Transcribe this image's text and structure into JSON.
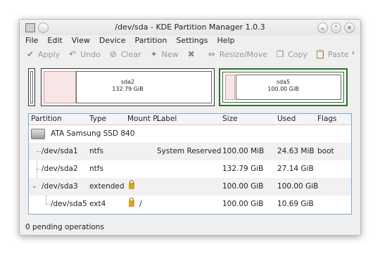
{
  "window": {
    "title": "/dev/sda - KDE Partition Manager 1.0.3"
  },
  "menu": [
    "File",
    "Edit",
    "View",
    "Device",
    "Partition",
    "Settings",
    "Help"
  ],
  "toolbar": {
    "apply": "Apply",
    "undo": "Undo",
    "clear": "Clear",
    "new": "New",
    "delete": "Delete",
    "resize": "Resize/Move",
    "copy": "Copy",
    "paste": "Paste"
  },
  "graph": {
    "sda2": {
      "name": "sda2",
      "size": "132.79 GiB"
    },
    "sda5": {
      "name": "sda5",
      "size": "100.00 GiB"
    }
  },
  "table": {
    "headers": [
      "Partition",
      "Type",
      "Mount P...",
      "Label",
      "Size",
      "Used",
      "Flags"
    ],
    "device": "ATA Samsung SSD 840",
    "rows": [
      {
        "partition": "/dev/sda1",
        "type": "ntfs",
        "mount": "",
        "label": "System Reserved",
        "size": "100.00 MiB",
        "used": "24.63 MiB",
        "flags": "boot",
        "locked": false
      },
      {
        "partition": "/dev/sda2",
        "type": "ntfs",
        "mount": "",
        "label": "",
        "size": "132.79 GiB",
        "used": "27.14 GiB",
        "flags": "",
        "locked": false
      },
      {
        "partition": "/dev/sda3",
        "type": "extended",
        "mount": "",
        "label": "",
        "size": "100.00 GiB",
        "used": "100.00 GiB",
        "flags": "",
        "locked": true
      },
      {
        "partition": "/dev/sda5",
        "type": "ext4",
        "mount": "/",
        "label": "",
        "size": "100.00 GiB",
        "used": "10.69 GiB",
        "flags": "",
        "locked": true
      }
    ]
  },
  "status": "0 pending operations",
  "colors": {
    "accent_border": "#7fa7cf",
    "extended_border": "#2f6b2f",
    "partition_fill": "#f8e6e6"
  }
}
